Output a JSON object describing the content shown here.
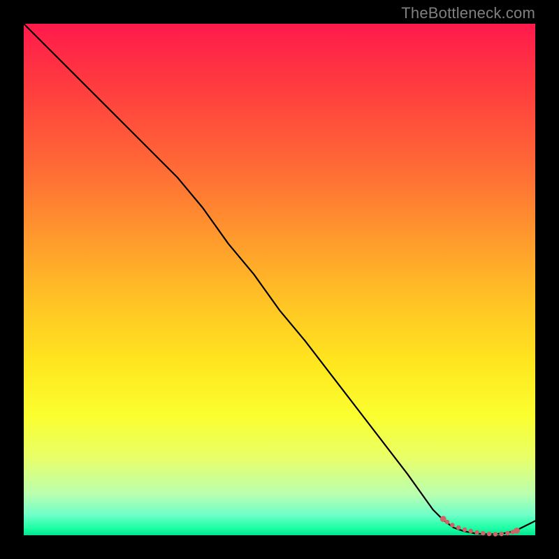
{
  "watermark": {
    "text": "TheBottleneck.com"
  },
  "colors": {
    "page_bg": "#000000",
    "curve": "#000000",
    "dots": "#cc6666",
    "gradient_top": "#ff1a4c",
    "gradient_bottom": "#00e490"
  },
  "chart_data": {
    "type": "line",
    "title": "",
    "xlabel": "",
    "ylabel": "",
    "xlim": [
      0,
      100
    ],
    "ylim": [
      0,
      100
    ],
    "grid": false,
    "legend": false,
    "series": [
      {
        "name": "curve",
        "x": [
          0,
          5,
          10,
          15,
          20,
          25,
          27,
          30,
          35,
          40,
          45,
          50,
          55,
          60,
          65,
          70,
          75,
          80,
          82,
          84,
          86,
          88,
          90,
          92,
          94,
          96,
          100
        ],
        "values": [
          100,
          95,
          90,
          85,
          80,
          75,
          73,
          70,
          64,
          57,
          51,
          44,
          38,
          31.5,
          25,
          18.5,
          12,
          5,
          3,
          1.5,
          0.8,
          0.4,
          0.2,
          0.2,
          0.4,
          0.8,
          2.8
        ]
      }
    ],
    "dot_overlay": {
      "name": "green-zone-dots",
      "x": [
        82.0,
        82.8,
        83.8,
        85.0,
        86.2,
        87.4,
        88.6,
        89.8,
        91.0,
        92.2,
        93.4,
        94.6,
        95.6,
        96.4
      ],
      "values": [
        3.2,
        2.6,
        2.0,
        1.5,
        1.1,
        0.8,
        0.55,
        0.4,
        0.28,
        0.22,
        0.26,
        0.4,
        0.62,
        0.9
      ]
    }
  }
}
